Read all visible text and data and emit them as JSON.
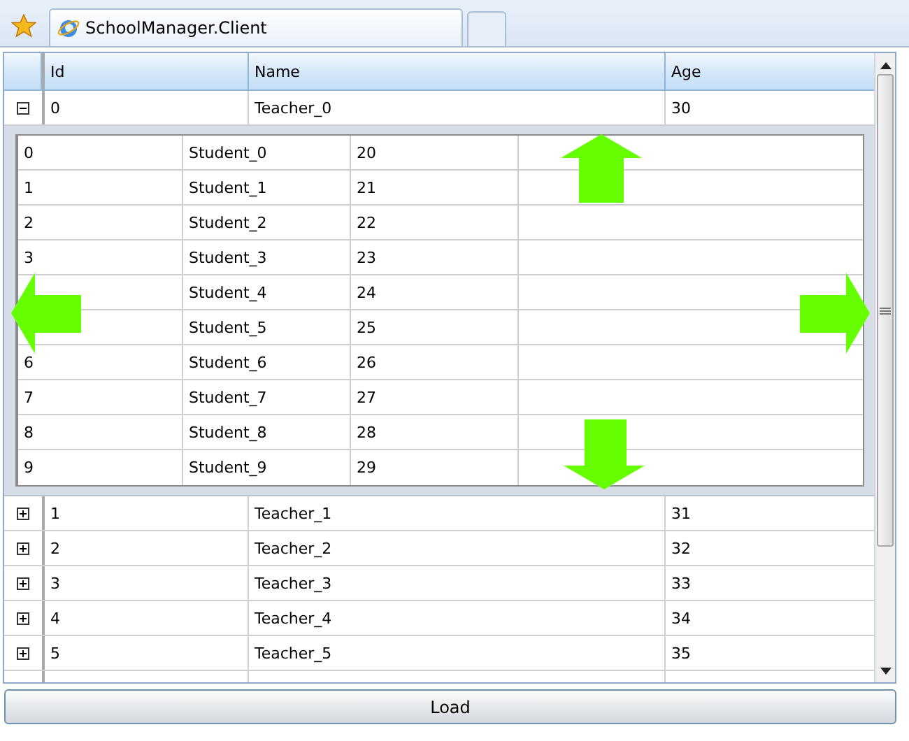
{
  "browser": {
    "tabs": [
      {
        "title": "SchoolManager.Client",
        "selected": true
      }
    ]
  },
  "grid": {
    "columns": [
      "Id",
      "Name",
      "Age"
    ],
    "rows": [
      {
        "id": "0",
        "name": "Teacher_0",
        "age": "30",
        "expanded": true,
        "students": [
          {
            "id": "0",
            "name": "Student_0",
            "age": "20"
          },
          {
            "id": "1",
            "name": "Student_1",
            "age": "21"
          },
          {
            "id": "2",
            "name": "Student_2",
            "age": "22"
          },
          {
            "id": "3",
            "name": "Student_3",
            "age": "23"
          },
          {
            "name": "Student_4",
            "age": "24"
          },
          {
            "name": "Student_5",
            "age": "25"
          },
          {
            "id": "6",
            "name": "Student_6",
            "age": "26"
          },
          {
            "id": "7",
            "name": "Student_7",
            "age": "27"
          },
          {
            "id": "8",
            "name": "Student_8",
            "age": "28"
          },
          {
            "id": "9",
            "name": "Student_9",
            "age": "29"
          }
        ]
      },
      {
        "id": "1",
        "name": "Teacher_1",
        "age": "31",
        "expanded": false
      },
      {
        "id": "2",
        "name": "Teacher_2",
        "age": "32",
        "expanded": false
      },
      {
        "id": "3",
        "name": "Teacher_3",
        "age": "33",
        "expanded": false
      },
      {
        "id": "4",
        "name": "Teacher_4",
        "age": "34",
        "expanded": false
      },
      {
        "id": "5",
        "name": "Teacher_5",
        "age": "35",
        "expanded": false
      }
    ]
  },
  "load_button": "Load",
  "overlay_arrows": [
    {
      "kind": "up"
    },
    {
      "kind": "left"
    },
    {
      "kind": "right"
    },
    {
      "kind": "down"
    }
  ]
}
